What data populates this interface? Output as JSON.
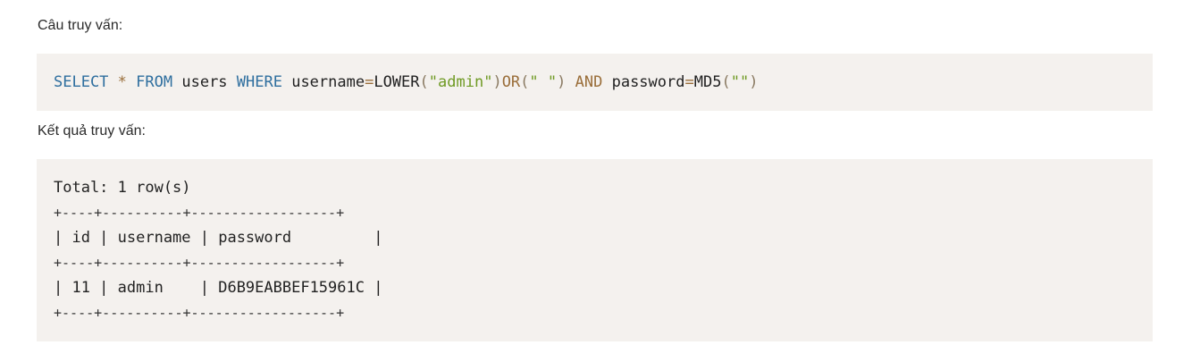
{
  "labels": {
    "query": "Câu truy vấn:",
    "result": "Kết quả truy vấn:"
  },
  "query": {
    "tokens": [
      {
        "text": "SELECT",
        "type": "keyword"
      },
      {
        "text": " ",
        "type": "plain"
      },
      {
        "text": "*",
        "type": "operator"
      },
      {
        "text": " ",
        "type": "plain"
      },
      {
        "text": "FROM",
        "type": "keyword"
      },
      {
        "text": " users ",
        "type": "plain"
      },
      {
        "text": "WHERE",
        "type": "keyword"
      },
      {
        "text": " username",
        "type": "plain"
      },
      {
        "text": "=",
        "type": "operator"
      },
      {
        "text": "LOWER",
        "type": "function"
      },
      {
        "text": "(",
        "type": "paren"
      },
      {
        "text": "\"admin\"",
        "type": "string"
      },
      {
        "text": ")",
        "type": "paren"
      },
      {
        "text": "OR",
        "type": "keyword2"
      },
      {
        "text": "(",
        "type": "paren"
      },
      {
        "text": "\" \"",
        "type": "string"
      },
      {
        "text": ")",
        "type": "paren"
      },
      {
        "text": " ",
        "type": "plain"
      },
      {
        "text": "AND",
        "type": "keyword2"
      },
      {
        "text": " password",
        "type": "plain"
      },
      {
        "text": "=",
        "type": "operator"
      },
      {
        "text": "MD5",
        "type": "function"
      },
      {
        "text": "(",
        "type": "paren"
      },
      {
        "text": "\"\"",
        "type": "string"
      },
      {
        "text": ")",
        "type": "paren"
      }
    ]
  },
  "result": {
    "total": "Total: 1 row(s)",
    "border": "+----+----------+------------------+",
    "header": "| id | username | password         |",
    "rows": [
      "| 11 | admin    | D6B9EABBEF15961C |"
    ]
  },
  "colors": {
    "code_background": "#f4f1ee",
    "keyword": "#2f6f9f",
    "string": "#6f9a24",
    "operator": "#9a6e3a"
  }
}
